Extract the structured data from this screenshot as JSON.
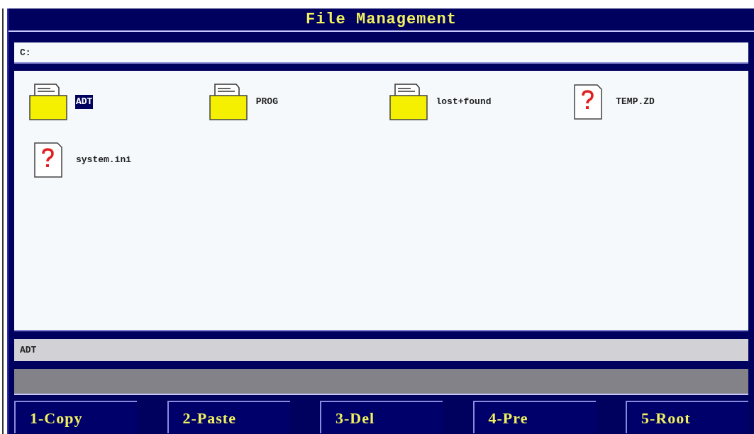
{
  "window": {
    "title": "File Management"
  },
  "path": {
    "value": "C:"
  },
  "files": [
    {
      "name": "ADT",
      "kind": "folder",
      "selected": true
    },
    {
      "name": "PROG",
      "kind": "folder",
      "selected": false
    },
    {
      "name": "lost+found",
      "kind": "folder",
      "selected": false
    },
    {
      "name": "TEMP.ZD",
      "kind": "unknown",
      "selected": false
    },
    {
      "name": "system.ini",
      "kind": "unknown",
      "selected": false
    }
  ],
  "status_bar": {
    "text": "ADT"
  },
  "buttons": [
    "1-Copy",
    "2-Paste",
    "3-Del",
    "4-Pre",
    "5-Root"
  ]
}
